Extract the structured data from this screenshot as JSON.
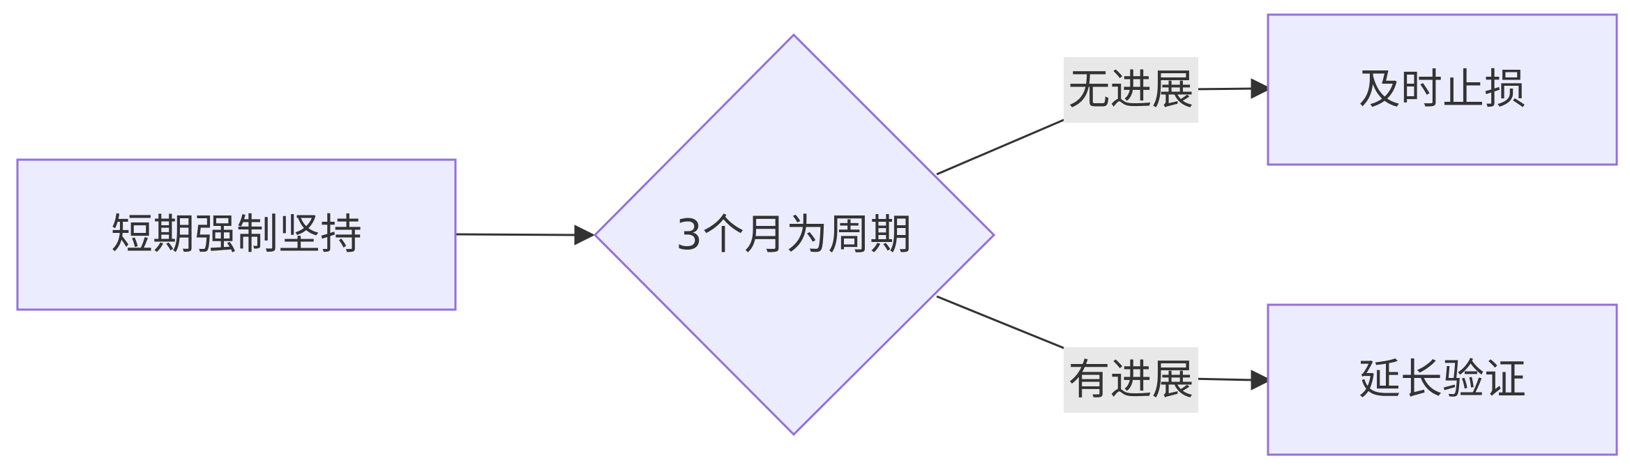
{
  "colors": {
    "node_fill": "#ececff",
    "node_stroke": "#9370db",
    "edge": "#333333",
    "edge_label_bg": "#e8e8e8",
    "text": "#333333"
  },
  "nodes": {
    "start": {
      "label": "短期强制坚持"
    },
    "decision": {
      "label": "3个月为周期"
    },
    "stop": {
      "label": "及时止损"
    },
    "extend": {
      "label": "延长验证"
    }
  },
  "edges": {
    "to_stop": {
      "label": "无进展"
    },
    "to_extend": {
      "label": "有进展"
    }
  }
}
